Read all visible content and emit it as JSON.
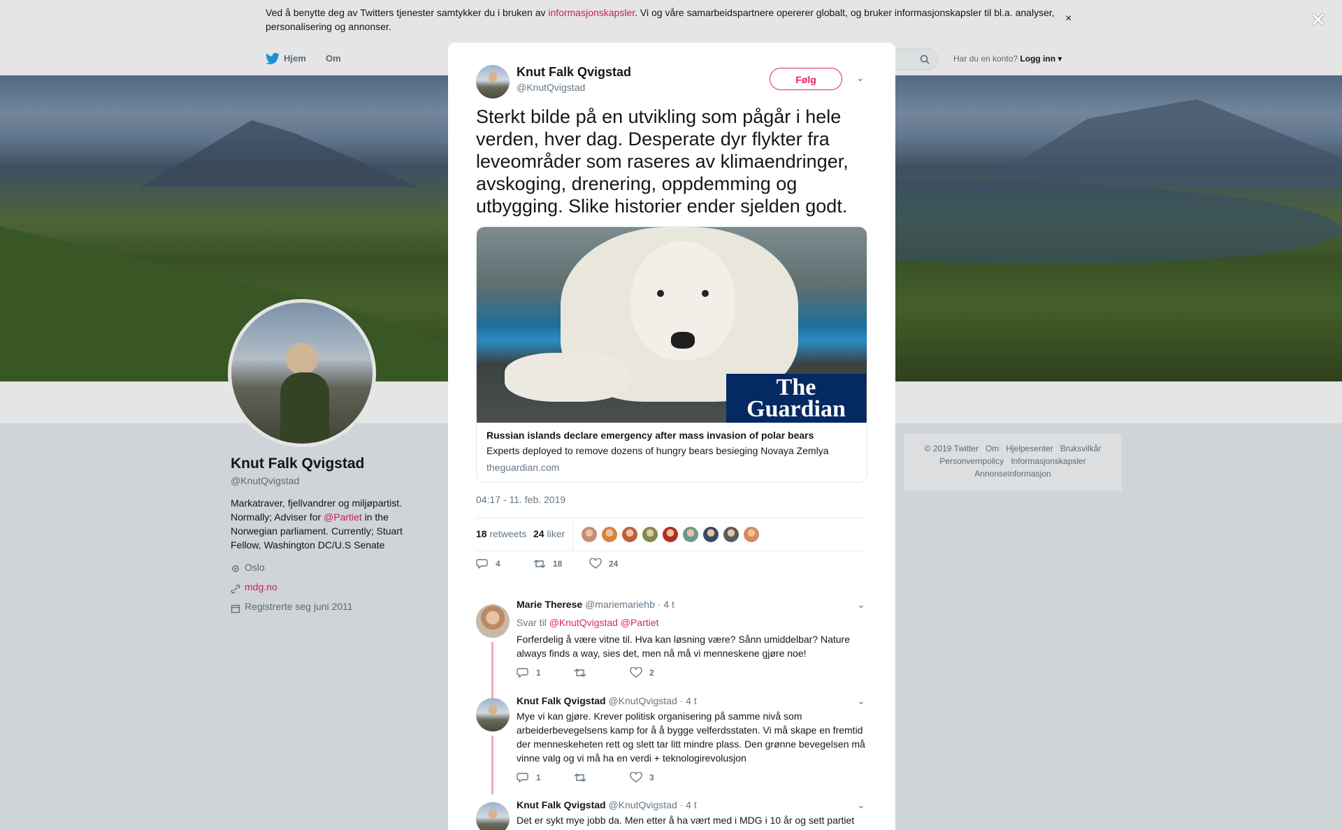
{
  "cookie": {
    "text_before": "Ved å benytte deg av Twitters tjenester samtykker du i bruken av ",
    "link": "informasjonskapsler",
    "text_after": ". Vi og våre samarbeidspartnere opererer globalt, og bruker informasjonskapsler til bl.a. analyser, personalisering og annonser.",
    "close": "×"
  },
  "nav": {
    "home": "Hjem",
    "about": "Om",
    "have_account": "Har du en konto?",
    "login": "Logg inn"
  },
  "overlay_close": "✕",
  "profile": {
    "name": "Knut Falk Qvigstad",
    "handle": "@KnutQvigstad",
    "bio_1": "Markatraver, fjellvandrer og miljøpartist. Normally; Adviser for ",
    "bio_link": "@Partiet",
    "bio_2": " in the Norwegian parliament. Currently; Stuart Fellow, Washington DC/U.S Senate",
    "location": "Oslo",
    "website": "mdg.no",
    "joined": "Registrerte seg juni 2011"
  },
  "footer": {
    "copyright": "© 2019 Twitter",
    "links_row1": [
      "Om",
      "Hjelpesenter",
      "Bruksvilkår"
    ],
    "links_row2": [
      "Personvernpolicy",
      "Informasjonskapsler"
    ],
    "links_row3": [
      "Annonseinformasjon"
    ]
  },
  "tweet": {
    "name": "Knut Falk Qvigstad",
    "handle": "@KnutQvigstad",
    "follow": "Følg",
    "text": "Sterkt bilde på en utvikling som pågår i hele verden, hver dag. Desperate dyr flykter fra leveområder som raseres av klimaendringer, avskoging, drenering, oppdemming og utbygging. Slike historier ender sjelden godt.",
    "card": {
      "logo_line1": "The",
      "logo_line2": "Guardian",
      "title": "Russian islands declare emergency after mass invasion of polar bears",
      "description": "Experts deployed to remove dozens of hungry bears besieging Novaya Zemlya",
      "url": "theguardian.com"
    },
    "timestamp": "04:17 - 11. feb. 2019",
    "retweets_count": "18",
    "retweets_label": "retweets",
    "likes_count": "24",
    "likes_label": "liker",
    "likers": [
      "#c98a7a",
      "#d9833e",
      "#c0603a",
      "#7b8c4c",
      "#b23020",
      "#6a9a8a",
      "#3b4a66",
      "#5a5a5a",
      "#d88a5a"
    ],
    "actions": {
      "replies": "4",
      "retweets": "18",
      "likes": "24"
    }
  },
  "replies": [
    {
      "name": "Marie Therese",
      "handle": "@mariemariehb",
      "time": "· 4 t",
      "reply_to_label": "Svar til",
      "reply_to_1": "@KnutQvigstad",
      "reply_to_2": "@Partiet",
      "text": "Forferdelig å være vitne til. Hva kan løsning være? Sånn umiddelbar? Nature always finds a way, sies det, men nå må vi menneskene gjøre noe!",
      "replies": "1",
      "retweets": "",
      "likes": "2"
    },
    {
      "name": "Knut Falk Qvigstad",
      "handle": "@KnutQvigstad",
      "time": "· 4 t",
      "text": "Mye vi kan gjøre. Krever politisk organisering på samme nivå som arbeiderbevegelsens kamp for å å bygge velferdsstaten. Vi må skape en fremtid der menneskeheten rett og slett tar litt mindre plass. Den grønne bevegelsen må vinne valg og vi må ha en verdi + teknologirevolusjon",
      "replies": "1",
      "retweets": "",
      "likes": "3"
    },
    {
      "name": "Knut Falk Qvigstad",
      "handle": "@KnutQvigstad",
      "time": "· 4 t",
      "text": "Det er sykt mye jobb da. Men etter å ha vært med i MDG i 10 år og sett partiet"
    }
  ]
}
